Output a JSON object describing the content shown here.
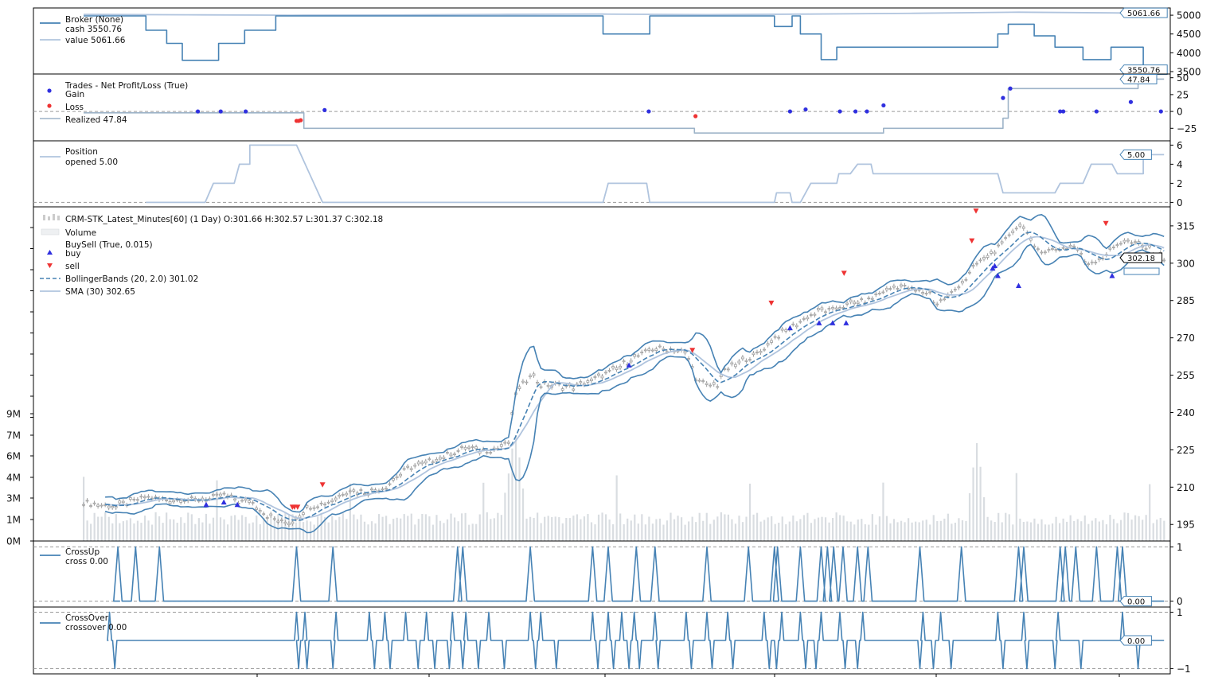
{
  "colors": {
    "dark_blue": "#4682b4",
    "light_blue": "#b0c4de",
    "gray_blue": "#9db3c8",
    "gain": "#2f2fdf",
    "loss": "#ee3333",
    "candle": "#9e9e9e",
    "volume": "#d9dde1",
    "dashed": "#9a9a9a"
  },
  "chart_data": [
    {
      "type": "line",
      "panel": "broker",
      "legend": {
        "title": "Broker (None)",
        "cash_label": "cash 3550.76",
        "value_label": "value 5061.66"
      },
      "y_ticks": [
        "5000",
        "4500",
        "4000",
        "3500"
      ],
      "ylim": [
        3500,
        5150
      ],
      "last_value_tag": "5061.66",
      "last_cash_tag": "3550.76",
      "series": [
        {
          "name": "cash",
          "color": "#4682b4",
          "values": [
            [
              0,
              4980
            ],
            [
              0.06,
              4980
            ],
            [
              0.06,
              4600
            ],
            [
              0.08,
              4600
            ],
            [
              0.08,
              4250
            ],
            [
              0.095,
              4250
            ],
            [
              0.095,
              3800
            ],
            [
              0.13,
              3800
            ],
            [
              0.13,
              4250
            ],
            [
              0.155,
              4250
            ],
            [
              0.155,
              4600
            ],
            [
              0.185,
              4600
            ],
            [
              0.185,
              4980
            ],
            [
              0.5,
              4980
            ],
            [
              0.5,
              4500
            ],
            [
              0.545,
              4500
            ],
            [
              0.545,
              4980
            ],
            [
              0.665,
              4980
            ],
            [
              0.665,
              4700
            ],
            [
              0.682,
              4700
            ],
            [
              0.682,
              4980
            ],
            [
              0.69,
              4980
            ],
            [
              0.69,
              4500
            ],
            [
              0.71,
              4500
            ],
            [
              0.71,
              3820
            ],
            [
              0.725,
              3820
            ],
            [
              0.725,
              4150
            ],
            [
              0.88,
              4150
            ],
            [
              0.88,
              4500
            ],
            [
              0.89,
              4500
            ],
            [
              0.89,
              4760
            ],
            [
              0.915,
              4760
            ],
            [
              0.915,
              4450
            ],
            [
              0.935,
              4450
            ],
            [
              0.935,
              4150
            ],
            [
              0.962,
              4150
            ],
            [
              0.962,
              3820
            ],
            [
              0.989,
              3820
            ],
            [
              0.989,
              4150
            ],
            [
              1.02,
              4150
            ],
            [
              1.02,
              3550
            ],
            [
              1.04,
              3550
            ]
          ]
        },
        {
          "name": "value",
          "color": "#b0c4de",
          "values": [
            [
              0,
              5020
            ],
            [
              0.1,
              5010
            ],
            [
              0.2,
              5000
            ],
            [
              0.3,
              5005
            ],
            [
              0.4,
              5020
            ],
            [
              0.5,
              5030
            ],
            [
              0.6,
              5015
            ],
            [
              0.7,
              5030
            ],
            [
              0.8,
              5050
            ],
            [
              0.9,
              5080
            ],
            [
              1.0,
              5060
            ],
            [
              1.04,
              5062
            ]
          ]
        }
      ]
    },
    {
      "type": "scatter",
      "panel": "trades",
      "legend": {
        "title": "Trades - Net Profit/Loss (True)",
        "gain_label": "Gain",
        "loss_label": "Loss",
        "realized_label": "Realized 47.84"
      },
      "y_ticks": [
        "50",
        "25",
        "0",
        "−25"
      ],
      "ylim": [
        -40,
        52
      ],
      "last_value_tag": "47.84",
      "gains": [
        [
          0.11,
          0
        ],
        [
          0.132,
          0
        ],
        [
          0.156,
          0
        ],
        [
          0.232,
          2
        ],
        [
          0.544,
          0
        ],
        [
          0.68,
          0
        ],
        [
          0.695,
          3
        ],
        [
          0.728,
          0
        ],
        [
          0.743,
          0
        ],
        [
          0.754,
          0
        ],
        [
          0.77,
          9
        ],
        [
          0.885,
          20
        ],
        [
          0.892,
          34
        ],
        [
          0.94,
          0
        ],
        [
          0.943,
          0
        ],
        [
          0.975,
          0
        ],
        [
          1.008,
          14
        ],
        [
          1.037,
          0
        ]
      ],
      "losses": [
        [
          0.205,
          -14
        ],
        [
          0.207,
          -14
        ],
        [
          0.209,
          -13
        ],
        [
          0.589,
          -7
        ]
      ],
      "realized": [
        [
          0,
          -2
        ],
        [
          0.212,
          -2
        ],
        [
          0.212,
          -25
        ],
        [
          0.588,
          -25
        ],
        [
          0.588,
          -32
        ],
        [
          0.77,
          -32
        ],
        [
          0.77,
          -25
        ],
        [
          0.885,
          -25
        ],
        [
          0.885,
          -10
        ],
        [
          0.89,
          -10
        ],
        [
          0.89,
          34
        ],
        [
          1.015,
          34
        ],
        [
          1.015,
          48
        ],
        [
          1.04,
          48
        ]
      ]
    },
    {
      "type": "line",
      "panel": "position",
      "legend": {
        "title": "Position",
        "opened_label": "opened 5.00"
      },
      "y_ticks": [
        "6",
        "4",
        "2",
        "0"
      ],
      "ylim": [
        -0.3,
        6.2
      ],
      "last_value_tag": "5.00",
      "series": [
        {
          "name": "position",
          "color": "#b0c4de",
          "values": [
            [
              0.06,
              0
            ],
            [
              0.117,
              0
            ],
            [
              0.125,
              2
            ],
            [
              0.145,
              2
            ],
            [
              0.15,
              4
            ],
            [
              0.16,
              4
            ],
            [
              0.16,
              6
            ],
            [
              0.205,
              6
            ],
            [
              0.23,
              0
            ],
            [
              0.5,
              0
            ],
            [
              0.505,
              2
            ],
            [
              0.542,
              2
            ],
            [
              0.545,
              0
            ],
            [
              0.665,
              0
            ],
            [
              0.667,
              1
            ],
            [
              0.68,
              1
            ],
            [
              0.682,
              0
            ],
            [
              0.69,
              0
            ],
            [
              0.7,
              2
            ],
            [
              0.725,
              2
            ],
            [
              0.727,
              3
            ],
            [
              0.738,
              3
            ],
            [
              0.745,
              4
            ],
            [
              0.758,
              4
            ],
            [
              0.76,
              3
            ],
            [
              0.88,
              3
            ],
            [
              0.885,
              1
            ],
            [
              0.935,
              1
            ],
            [
              0.94,
              2
            ],
            [
              0.962,
              2
            ],
            [
              0.97,
              4
            ],
            [
              0.99,
              4
            ],
            [
              0.995,
              3
            ],
            [
              1.02,
              3
            ],
            [
              1.02,
              5
            ],
            [
              1.04,
              5
            ]
          ]
        }
      ]
    },
    {
      "type": "line",
      "panel": "price",
      "legend": {
        "ohlc_label": "CRM-STK_Latest_Minutes[60] (1 Day) O:301.66 H:302.57 L:301.37 C:302.18",
        "volume_label": "Volume",
        "buysell_label": "BuySell (True, 0.015)",
        "buy_label": "buy",
        "sell_label": "sell",
        "bbands_label": "BollingerBands (20, 2.0) 301.02",
        "sma_label": "SMA (30) 302.65"
      },
      "y_ticks": [
        "315",
        "300",
        "285",
        "270",
        "255",
        "240",
        "225",
        "210",
        "195"
      ],
      "volume_ticks": [
        "9M",
        "7M",
        "6M",
        "4M",
        "3M",
        "1M",
        "0M"
      ],
      "ylim": [
        189,
        322
      ],
      "last_value_tag": "302.18",
      "close": [
        [
          0,
          204
        ],
        [
          0.03,
          202
        ],
        [
          0.06,
          206
        ],
        [
          0.08,
          205
        ],
        [
          0.1,
          205
        ],
        [
          0.12,
          205
        ],
        [
          0.135,
          207
        ],
        [
          0.15,
          204
        ],
        [
          0.16,
          205
        ],
        [
          0.175,
          199
        ],
        [
          0.19,
          196
        ],
        [
          0.2,
          196
        ],
        [
          0.215,
          202
        ],
        [
          0.235,
          204
        ],
        [
          0.255,
          209
        ],
        [
          0.27,
          208
        ],
        [
          0.29,
          210
        ],
        [
          0.31,
          217
        ],
        [
          0.33,
          220
        ],
        [
          0.35,
          223
        ],
        [
          0.37,
          226
        ],
        [
          0.38,
          225
        ],
        [
          0.395,
          225
        ],
        [
          0.41,
          228
        ],
        [
          0.415,
          248
        ],
        [
          0.425,
          252
        ],
        [
          0.43,
          256
        ],
        [
          0.44,
          251
        ],
        [
          0.455,
          251
        ],
        [
          0.47,
          250
        ],
        [
          0.49,
          253
        ],
        [
          0.51,
          257
        ],
        [
          0.53,
          262
        ],
        [
          0.55,
          266
        ],
        [
          0.57,
          265
        ],
        [
          0.58,
          264
        ],
        [
          0.59,
          253
        ],
        [
          0.6,
          251
        ],
        [
          0.61,
          251
        ],
        [
          0.615,
          256
        ],
        [
          0.63,
          260
        ],
        [
          0.65,
          264
        ],
        [
          0.665,
          270
        ],
        [
          0.68,
          274
        ],
        [
          0.695,
          278
        ],
        [
          0.71,
          281
        ],
        [
          0.72,
          281
        ],
        [
          0.74,
          284
        ],
        [
          0.755,
          285
        ],
        [
          0.77,
          289
        ],
        [
          0.785,
          291
        ],
        [
          0.8,
          289
        ],
        [
          0.815,
          288
        ],
        [
          0.82,
          283
        ],
        [
          0.835,
          288
        ],
        [
          0.85,
          294
        ],
        [
          0.86,
          300
        ],
        [
          0.875,
          304
        ],
        [
          0.885,
          308
        ],
        [
          0.895,
          314
        ],
        [
          0.905,
          315
        ],
        [
          0.915,
          306
        ],
        [
          0.925,
          305
        ],
        [
          0.94,
          306
        ],
        [
          0.955,
          307
        ],
        [
          0.965,
          300
        ],
        [
          0.98,
          302
        ],
        [
          0.99,
          306
        ],
        [
          1.0,
          309
        ],
        [
          1.02,
          307
        ],
        [
          1.04,
          302
        ]
      ],
      "buys": [
        [
          0.118,
          203
        ],
        [
          0.135,
          204
        ],
        [
          0.148,
          203
        ],
        [
          0.525,
          259
        ],
        [
          0.68,
          274
        ],
        [
          0.708,
          276
        ],
        [
          0.721,
          276
        ],
        [
          0.734,
          276
        ],
        [
          0.875,
          298
        ],
        [
          0.877,
          299
        ],
        [
          0.88,
          295
        ],
        [
          0.9,
          291
        ],
        [
          0.99,
          295
        ]
      ],
      "sells": [
        [
          0.201,
          202
        ],
        [
          0.203,
          202
        ],
        [
          0.206,
          202
        ],
        [
          0.23,
          211
        ],
        [
          0.586,
          265
        ],
        [
          0.662,
          284
        ],
        [
          0.732,
          296
        ],
        [
          0.855,
          309
        ],
        [
          0.859,
          321
        ],
        [
          0.984,
          316
        ]
      ]
    },
    {
      "type": "line",
      "panel": "crossup",
      "legend": {
        "title": "CrossUp",
        "cross_label": "cross 0.00"
      },
      "y_ticks": [
        "1",
        "0"
      ],
      "ylim": [
        -0.05,
        1.05
      ],
      "last_value_tag": "0.00",
      "spikes": [
        0.033,
        0.05,
        0.073,
        0.205,
        0.24,
        0.36,
        0.365,
        0.43,
        0.49,
        0.505,
        0.532,
        0.55,
        0.6,
        0.64,
        0.665,
        0.668,
        0.69,
        0.71,
        0.716,
        0.722,
        0.731,
        0.745,
        0.755,
        0.805,
        0.845,
        0.9,
        0.905,
        0.94,
        0.945,
        0.955,
        0.975,
        0.995,
        1.0
      ]
    },
    {
      "type": "line",
      "panel": "crossover",
      "legend": {
        "title": "CrossOver",
        "crossover_label": "crossover 0.00"
      },
      "y_ticks": [
        "1",
        "−1"
      ],
      "ylim": [
        -1.1,
        1.1
      ],
      "last_value_tag": "0.00",
      "events": [
        [
          0.025,
          1
        ],
        [
          0.03,
          -1
        ],
        [
          0.205,
          1
        ],
        [
          0.207,
          -1
        ],
        [
          0.213,
          1
        ],
        [
          0.215,
          -1
        ],
        [
          0.24,
          -1
        ],
        [
          0.243,
          1
        ],
        [
          0.275,
          1
        ],
        [
          0.28,
          -1
        ],
        [
          0.29,
          1
        ],
        [
          0.295,
          -1
        ],
        [
          0.31,
          1
        ],
        [
          0.322,
          -1
        ],
        [
          0.33,
          1
        ],
        [
          0.338,
          -1
        ],
        [
          0.352,
          -1
        ],
        [
          0.355,
          1
        ],
        [
          0.365,
          -1
        ],
        [
          0.368,
          1
        ],
        [
          0.38,
          -1
        ],
        [
          0.39,
          1
        ],
        [
          0.405,
          -1
        ],
        [
          0.43,
          1
        ],
        [
          0.435,
          -1
        ],
        [
          0.44,
          1
        ],
        [
          0.455,
          -1
        ],
        [
          0.49,
          1
        ],
        [
          0.495,
          -1
        ],
        [
          0.505,
          1
        ],
        [
          0.51,
          -1
        ],
        [
          0.518,
          1
        ],
        [
          0.525,
          -1
        ],
        [
          0.53,
          1
        ],
        [
          0.535,
          -1
        ],
        [
          0.55,
          1
        ],
        [
          0.553,
          -1
        ],
        [
          0.58,
          1
        ],
        [
          0.585,
          -1
        ],
        [
          0.6,
          1
        ],
        [
          0.605,
          -1
        ],
        [
          0.62,
          1
        ],
        [
          0.625,
          -1
        ],
        [
          0.655,
          1
        ],
        [
          0.66,
          -1
        ],
        [
          0.667,
          -1
        ],
        [
          0.672,
          1
        ],
        [
          0.69,
          1
        ],
        [
          0.695,
          -1
        ],
        [
          0.705,
          -1
        ],
        [
          0.71,
          1
        ],
        [
          0.728,
          1
        ],
        [
          0.733,
          -1
        ],
        [
          0.745,
          -1
        ],
        [
          0.75,
          1
        ],
        [
          0.805,
          -1
        ],
        [
          0.808,
          1
        ],
        [
          0.818,
          -1
        ],
        [
          0.825,
          1
        ],
        [
          0.835,
          -1
        ],
        [
          0.88,
          1
        ],
        [
          0.885,
          -1
        ],
        [
          0.905,
          1
        ],
        [
          0.908,
          -1
        ],
        [
          0.935,
          -1
        ],
        [
          0.938,
          1
        ],
        [
          0.96,
          -1
        ],
        [
          1.0,
          1
        ],
        [
          1.015,
          -1
        ]
      ]
    }
  ]
}
